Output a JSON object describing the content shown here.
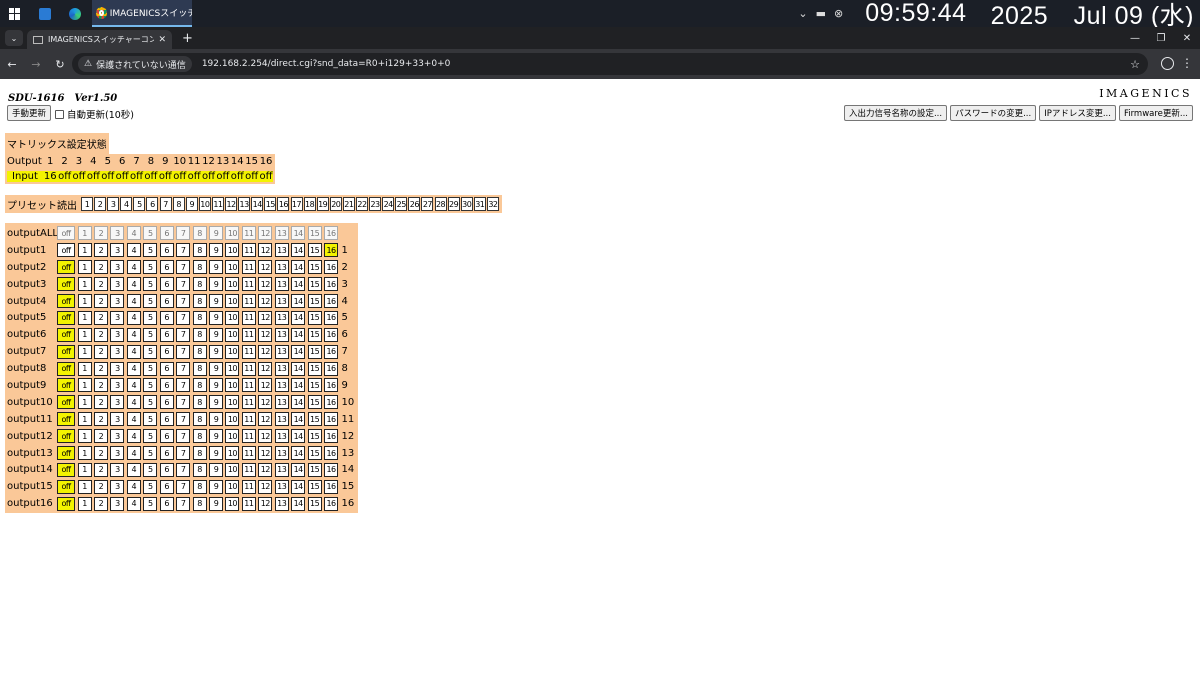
{
  "taskbar": {
    "chrome_label": "IMAGENICSスイッチャ...",
    "clock_time": "09:59:44",
    "clock_date": "2025　Jul 09 (水)"
  },
  "browser": {
    "tab_title": "IMAGENICSスイッチャーコントローラ",
    "security_label": "保護されていない通信",
    "url": "192.168.2.254/direct.cgi?snd_data=R0+i129+33+0+0"
  },
  "page": {
    "model": "SDU-1616　Ver1.50",
    "brand": "IMAGENICS",
    "manual_refresh_label": "手動更新",
    "auto_refresh_label": "自動更新(10秒)",
    "right_buttons": [
      "入出力信号名称の設定...",
      "パスワードの変更...",
      "IPアドレス変更...",
      "Firmware更新..."
    ]
  },
  "matrix_status": {
    "title": "マトリックス設定状態",
    "output_label": "Output",
    "input_label": "Input",
    "outputs": [
      "1",
      "2",
      "3",
      "4",
      "5",
      "6",
      "7",
      "8",
      "9",
      "10",
      "11",
      "12",
      "13",
      "14",
      "15",
      "16"
    ],
    "inputs": [
      "16",
      "off",
      "off",
      "off",
      "off",
      "off",
      "off",
      "off",
      "off",
      "off",
      "off",
      "off",
      "off",
      "off",
      "off",
      "off"
    ]
  },
  "preset": {
    "label": "プリセット読出",
    "buttons": [
      "1",
      "2",
      "3",
      "4",
      "5",
      "6",
      "7",
      "8",
      "9",
      "10",
      "11",
      "12",
      "13",
      "14",
      "15",
      "16",
      "17",
      "18",
      "19",
      "20",
      "21",
      "22",
      "23",
      "24",
      "25",
      "26",
      "27",
      "28",
      "29",
      "30",
      "31",
      "32"
    ]
  },
  "routing": {
    "all_label": "outputALL",
    "off_label": "off",
    "inputs": [
      "1",
      "2",
      "3",
      "4",
      "5",
      "6",
      "7",
      "8",
      "9",
      "10",
      "11",
      "12",
      "13",
      "14",
      "15",
      "16"
    ],
    "rows": [
      {
        "label": "output1",
        "num": "1",
        "selected": "16"
      },
      {
        "label": "output2",
        "num": "2",
        "selected": "off"
      },
      {
        "label": "output3",
        "num": "3",
        "selected": "off"
      },
      {
        "label": "output4",
        "num": "4",
        "selected": "off"
      },
      {
        "label": "output5",
        "num": "5",
        "selected": "off"
      },
      {
        "label": "output6",
        "num": "6",
        "selected": "off"
      },
      {
        "label": "output7",
        "num": "7",
        "selected": "off"
      },
      {
        "label": "output8",
        "num": "8",
        "selected": "off"
      },
      {
        "label": "output9",
        "num": "9",
        "selected": "off"
      },
      {
        "label": "output10",
        "num": "10",
        "selected": "off"
      },
      {
        "label": "output11",
        "num": "11",
        "selected": "off"
      },
      {
        "label": "output12",
        "num": "12",
        "selected": "off"
      },
      {
        "label": "output13",
        "num": "13",
        "selected": "off"
      },
      {
        "label": "output14",
        "num": "14",
        "selected": "off"
      },
      {
        "label": "output15",
        "num": "15",
        "selected": "off"
      },
      {
        "label": "output16",
        "num": "16",
        "selected": "off"
      }
    ]
  },
  "colors": {
    "panel_bg": "#fac898",
    "selected_bg": "#f3f300",
    "taskbar_bg": "#1b1f27"
  }
}
